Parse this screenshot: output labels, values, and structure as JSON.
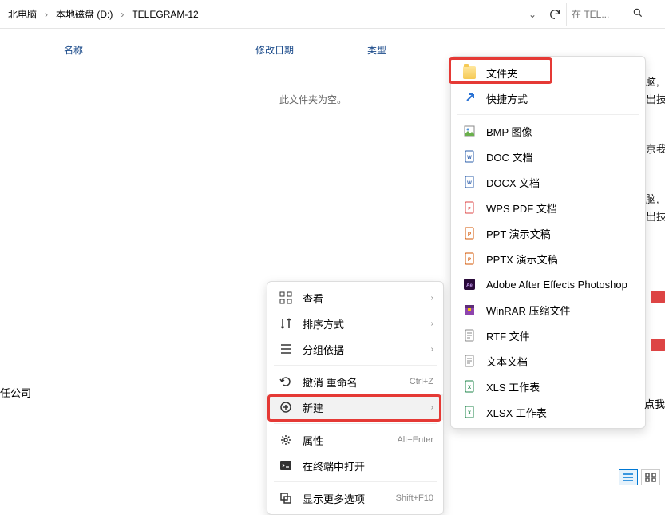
{
  "breadcrumb": {
    "p0": "北电脑",
    "p1": "本地磁盘 (D:)",
    "p2": "TELEGRAM-12"
  },
  "search": {
    "placeholder": "在 TEL..."
  },
  "cols": {
    "name": "名称",
    "date": "修改日期",
    "type": "类型"
  },
  "empty": "此文件夹为空。",
  "menu": {
    "view": "查看",
    "sort": "排序方式",
    "group": "分组依据",
    "undo": "撤消 重命名",
    "undo_sc": "Ctrl+Z",
    "new": "新建",
    "props": "属性",
    "props_sc": "Alt+Enter",
    "term": "在终端中打开",
    "more": "显示更多选项",
    "more_sc": "Shift+F10"
  },
  "sub": {
    "folder": "文件夹",
    "shortcut": "快捷方式",
    "bmp": "BMP 图像",
    "doc": "DOC 文档",
    "docx": "DOCX 文档",
    "wps": "WPS PDF 文档",
    "ppt": "PPT 演示文稿",
    "pptx": "PPTX 演示文稿",
    "ae": "Adobe After Effects Photoshop",
    "rar": "WinRAR 压缩文件",
    "rtf": "RTF 文件",
    "txt": "文本文档",
    "xls": "XLS 工作表",
    "xlsx": "XLSX 工作表"
  },
  "rsnips": {
    "a": "脑,",
    "b": "出技",
    "c": "京我",
    "d": "脑,",
    "e": "出技",
    "f": "任公司",
    "g": "点我"
  }
}
